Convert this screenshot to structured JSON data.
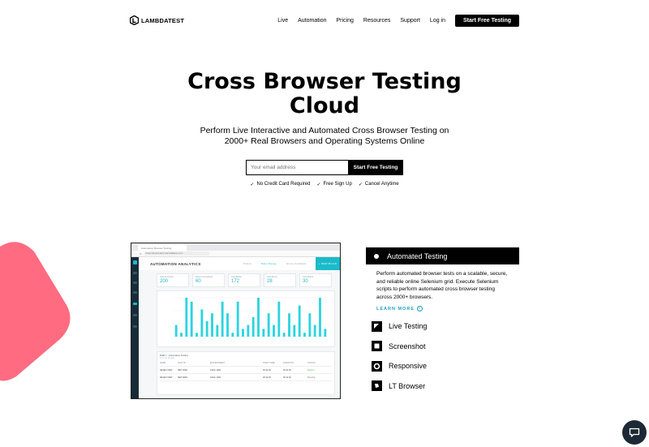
{
  "nav": {
    "logo_text": "LAMBDATEST",
    "links": [
      "Live",
      "Automation",
      "Pricing",
      "Resources",
      "Support",
      "Log in"
    ],
    "cta": "Start Free Testing"
  },
  "hero": {
    "title_line1": "Cross Browser Testing",
    "title_line2": "Cloud",
    "subtitle_line1": "Perform Live Interactive and Automated Cross Browser Testing on",
    "subtitle_line2": "2000+ Real Browsers and Operating Systems Online",
    "email_placeholder": "Your email address",
    "signup_button": "Start Free Testing",
    "perks": [
      "No Credit Card Required",
      "Free Sign Up",
      "Cancel Anytime"
    ]
  },
  "preview": {
    "tab_label": "Automation Browser Testing",
    "url": "https://automation.lambdatest.com",
    "app_title": "AUTOMATION ANALYTICS",
    "header_meta": [
      "Filters",
      "Date Range",
      "Since Installed"
    ],
    "new_button": "+ NEW BUILD",
    "stats": [
      {
        "label": "Total Tests Run",
        "value": "200"
      },
      {
        "label": "Passed Completed",
        "value": "60"
      },
      {
        "label": "Total Builds",
        "value": "172"
      },
      {
        "label": "Total Errors",
        "value": "28"
      },
      {
        "label": "Total Aborts",
        "value": "30"
      }
    ],
    "chart_data": {
      "type": "bar",
      "values": [
        3,
        1,
        10,
        9,
        1,
        7,
        4,
        6,
        3,
        9,
        6,
        1,
        9,
        2,
        3,
        5,
        10,
        2,
        6,
        3,
        9,
        1,
        6,
        3,
        8,
        1,
        6,
        3,
        10,
        2
      ],
      "color": "#2dd4df"
    },
    "table": {
      "title": "Build 1 - Automation Testing",
      "subtitle": "Test run all tests",
      "headers": [
        "NAME",
        "TEST ID",
        "ENVIRONMENT",
        "START TIME",
        "DURATION",
        "STATUS"
      ],
      "rows": [
        {
          "name": "SEVEN-TEST",
          "id": "SEIT 9090",
          "env": "1024x 1366",
          "start": "00:12:00",
          "duration": "00:12:00",
          "status": "Passed"
        },
        {
          "name": "SEVEN-TEST",
          "id": "SEIT 9090",
          "env": "1024x 1366",
          "start": "00:12:00",
          "duration": "00:12:00",
          "status": "Running..."
        }
      ]
    }
  },
  "features": {
    "active": {
      "title": "Automated Testing",
      "description": "Perform automated browser tests on a scalable, secure, and reliable online Selenium grid. Execute Selenium scripts to perform automated cross browser testing across 2000+ browsers.",
      "learn_more": "LEARN MORE"
    },
    "items": [
      {
        "label": "Live Testing",
        "icon": "live-testing-icon"
      },
      {
        "label": "Screenshot",
        "icon": "screenshot-icon"
      },
      {
        "label": "Responsive",
        "icon": "responsive-icon"
      },
      {
        "label": "LT Browser",
        "icon": "lt-browser-icon"
      }
    ]
  },
  "colors": {
    "accent_cyan": "#1bbac9",
    "blob": "#ff6b81",
    "link": "#1a9fbf"
  }
}
